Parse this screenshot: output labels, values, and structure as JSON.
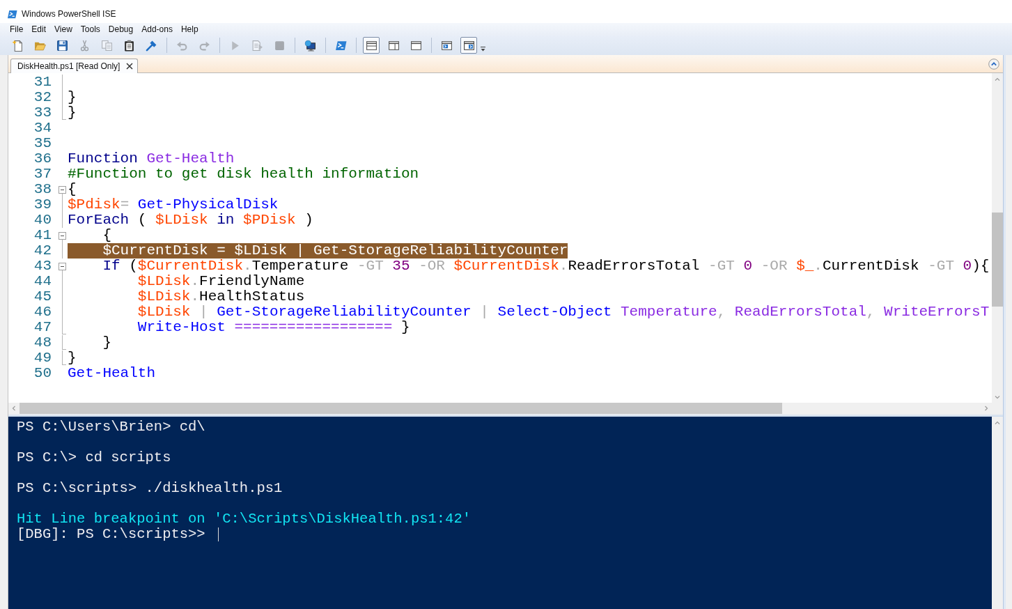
{
  "window": {
    "title": "Windows PowerShell ISE"
  },
  "menu": [
    "File",
    "Edit",
    "View",
    "Tools",
    "Debug",
    "Add-ons",
    "Help"
  ],
  "toolbar": {
    "groups": [
      [
        {
          "disabled": false,
          "pressed": false
        },
        {
          "disabled": false,
          "pressed": false
        },
        {
          "disabled": false,
          "pressed": false
        },
        {
          "disabled": true,
          "pressed": false
        },
        {
          "disabled": true,
          "pressed": false
        },
        {
          "disabled": false,
          "pressed": false
        },
        {
          "disabled": false,
          "pressed": false
        }
      ],
      [
        {
          "disabled": true,
          "pressed": false
        },
        {
          "disabled": true,
          "pressed": false
        }
      ],
      [
        {
          "disabled": true,
          "pressed": false
        },
        {
          "disabled": true,
          "pressed": false
        },
        {
          "disabled": true,
          "pressed": false
        }
      ],
      [
        {
          "disabled": false,
          "pressed": false
        }
      ],
      [
        {
          "disabled": false,
          "pressed": false
        }
      ],
      [
        {
          "disabled": false,
          "pressed": true
        },
        {
          "disabled": false,
          "pressed": false
        },
        {
          "disabled": false,
          "pressed": false
        }
      ],
      [
        {
          "disabled": false,
          "pressed": false
        },
        {
          "disabled": false,
          "pressed": true
        }
      ]
    ]
  },
  "tabs": [
    {
      "label": "DiskHealth.ps1 [Read Only]",
      "selected": true
    }
  ],
  "editor": {
    "lines": [
      {
        "number": "31",
        "kind": "guide",
        "current": false
      },
      {
        "number": "32",
        "kind": "guide",
        "current": false,
        "tokens": [
          {
            "text": "}",
            "kind": "group"
          }
        ]
      },
      {
        "number": "33",
        "kind": "end",
        "current": false,
        "tokens": [
          {
            "text": "}",
            "kind": "group"
          }
        ]
      },
      {
        "number": "34",
        "kind": "plain",
        "current": false
      },
      {
        "number": "35",
        "kind": "plain",
        "current": false
      },
      {
        "number": "36",
        "kind": "plain",
        "current": false,
        "tokens": [
          {
            "text": "Function ",
            "kind": "keyword"
          },
          {
            "text": "Get-Health",
            "kind": "argument"
          }
        ]
      },
      {
        "number": "37",
        "kind": "plain",
        "current": false,
        "tokens": [
          {
            "text": "#Function to get disk health information",
            "kind": "comment"
          }
        ]
      },
      {
        "number": "38",
        "kind": "toggle",
        "current": false,
        "tokens": [
          {
            "text": "{",
            "kind": "group"
          }
        ]
      },
      {
        "number": "39",
        "kind": "guide",
        "current": false,
        "tokens": [
          {
            "text": "$Pdisk",
            "kind": "variable"
          },
          {
            "text": "= ",
            "kind": "operator"
          },
          {
            "text": "Get-PhysicalDisk",
            "kind": "command"
          }
        ]
      },
      {
        "number": "40",
        "kind": "guide",
        "current": false,
        "tokens": [
          {
            "text": "ForEach ",
            "kind": "keyword"
          },
          {
            "text": "( ",
            "kind": "group"
          },
          {
            "text": "$LDisk ",
            "kind": "variable"
          },
          {
            "text": "in ",
            "kind": "keyword"
          },
          {
            "text": "$PDisk ",
            "kind": "variable"
          },
          {
            "text": ")",
            "kind": "group"
          }
        ]
      },
      {
        "number": "41",
        "kind": "toggle",
        "current": false,
        "tokens": [
          {
            "text": "    {",
            "kind": "group"
          }
        ]
      },
      {
        "number": "42",
        "kind": "guide",
        "current": true,
        "tokens": [
          {
            "text": "    $CurrentDisk",
            "kind": "variable"
          },
          {
            "text": " = ",
            "kind": "operator"
          },
          {
            "text": "$LDisk",
            "kind": "variable"
          },
          {
            "text": " | ",
            "kind": "operator"
          },
          {
            "text": "Get-StorageReliabilityCounter",
            "kind": "command"
          }
        ]
      },
      {
        "number": "43",
        "kind": "toggle",
        "current": false,
        "tokens": [
          {
            "text": "    If ",
            "kind": "keyword"
          },
          {
            "text": "(",
            "kind": "group"
          },
          {
            "text": "$CurrentDisk",
            "kind": "variable"
          },
          {
            "text": ".",
            "kind": "operator"
          },
          {
            "text": "Temperature ",
            "kind": "member"
          },
          {
            "text": "-GT ",
            "kind": "operator"
          },
          {
            "text": "35 ",
            "kind": "number"
          },
          {
            "text": "-OR ",
            "kind": "operator"
          },
          {
            "text": "$CurrentDisk",
            "kind": "variable"
          },
          {
            "text": ".",
            "kind": "operator"
          },
          {
            "text": "ReadErrorsTotal ",
            "kind": "member"
          },
          {
            "text": "-GT ",
            "kind": "operator"
          },
          {
            "text": "0 ",
            "kind": "number"
          },
          {
            "text": "-OR ",
            "kind": "operator"
          },
          {
            "text": "$_",
            "kind": "variable"
          },
          {
            "text": ".",
            "kind": "operator"
          },
          {
            "text": "CurrentDisk ",
            "kind": "member"
          },
          {
            "text": "-GT ",
            "kind": "operator"
          },
          {
            "text": "0",
            "kind": "number"
          },
          {
            "text": "){",
            "kind": "group"
          }
        ]
      },
      {
        "number": "44",
        "kind": "guide",
        "current": false,
        "tokens": [
          {
            "text": "        $LDisk",
            "kind": "variable"
          },
          {
            "text": ".",
            "kind": "operator"
          },
          {
            "text": "FriendlyName",
            "kind": "member"
          }
        ]
      },
      {
        "number": "45",
        "kind": "guide",
        "current": false,
        "tokens": [
          {
            "text": "        $LDisk",
            "kind": "variable"
          },
          {
            "text": ".",
            "kind": "operator"
          },
          {
            "text": "HealthStatus",
            "kind": "member"
          }
        ]
      },
      {
        "number": "46",
        "kind": "guide",
        "current": false,
        "tokens": [
          {
            "text": "        $LDisk ",
            "kind": "variable"
          },
          {
            "text": "| ",
            "kind": "operator"
          },
          {
            "text": "Get-StorageReliabilityCounter ",
            "kind": "command"
          },
          {
            "text": "| ",
            "kind": "operator"
          },
          {
            "text": "Select-Object ",
            "kind": "command"
          },
          {
            "text": "Temperature",
            "kind": "argument"
          },
          {
            "text": ", ",
            "kind": "operator"
          },
          {
            "text": "ReadErrorsTotal",
            "kind": "argument"
          },
          {
            "text": ", ",
            "kind": "operator"
          },
          {
            "text": "WriteErrorsT",
            "kind": "argument"
          }
        ]
      },
      {
        "number": "47",
        "kind": "end",
        "current": false,
        "tokens": [
          {
            "text": "        Write-Host ",
            "kind": "command"
          },
          {
            "text": "================== ",
            "kind": "argument"
          },
          {
            "text": "}",
            "kind": "group"
          }
        ]
      },
      {
        "number": "48",
        "kind": "end",
        "current": false,
        "tokens": [
          {
            "text": "    }",
            "kind": "group"
          }
        ]
      },
      {
        "number": "49",
        "kind": "end",
        "current": false,
        "tokens": [
          {
            "text": "}",
            "kind": "group"
          }
        ]
      },
      {
        "number": "50",
        "kind": "plain",
        "current": false,
        "tokens": [
          {
            "text": "Get-Health",
            "kind": "command"
          }
        ]
      }
    ]
  },
  "console": {
    "lines": [
      {
        "text": "PS C:\\Users\\Brien> cd\\",
        "kind": "input"
      },
      {
        "text": "PS C:\\> cd scripts",
        "kind": "input"
      },
      {
        "text": "PS C:\\scripts> ./diskhealth.ps1",
        "kind": "input"
      },
      {
        "text": "Hit Line breakpoint on 'C:\\Scripts\\DiskHealth.ps1:42'",
        "kind": "message"
      },
      {
        "text": "[DBG]: PS C:\\scripts>>",
        "kind": "prompt"
      }
    ]
  }
}
